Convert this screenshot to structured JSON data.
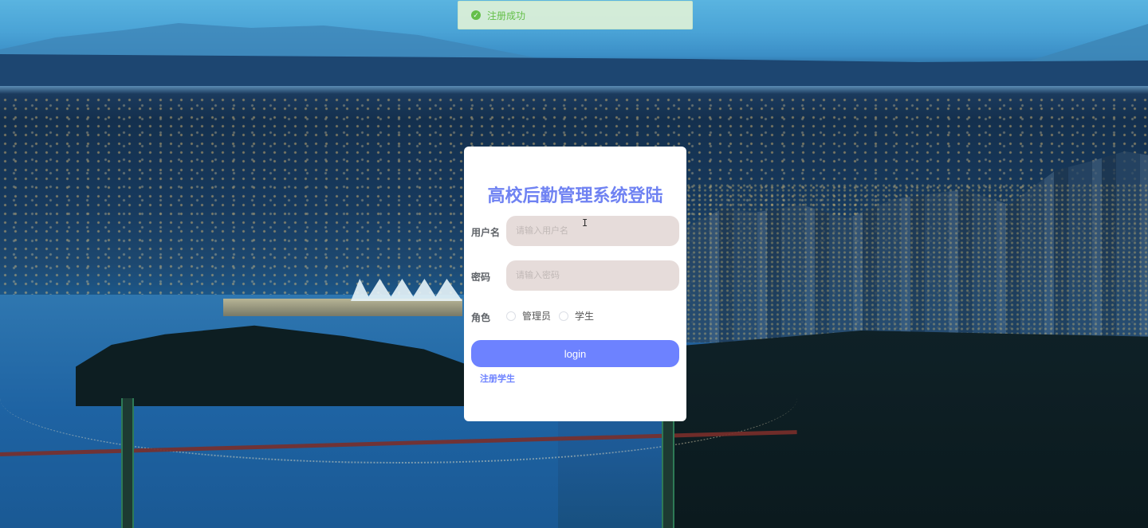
{
  "toast": {
    "message": "注册成功",
    "status": "success",
    "color": "#67c23a"
  },
  "login": {
    "title": "高校后勤管理系统登陆",
    "username_label": "用户名",
    "username_placeholder": "请输入用户名",
    "username_value": "",
    "password_label": "密码",
    "password_placeholder": "请输入密码",
    "password_value": "",
    "role_label": "角色",
    "roles": [
      {
        "label": "管理员",
        "selected": false
      },
      {
        "label": "学生",
        "selected": false
      }
    ],
    "submit_label": "login",
    "register_label": "注册学生",
    "accent_color": "#6d82ff"
  }
}
